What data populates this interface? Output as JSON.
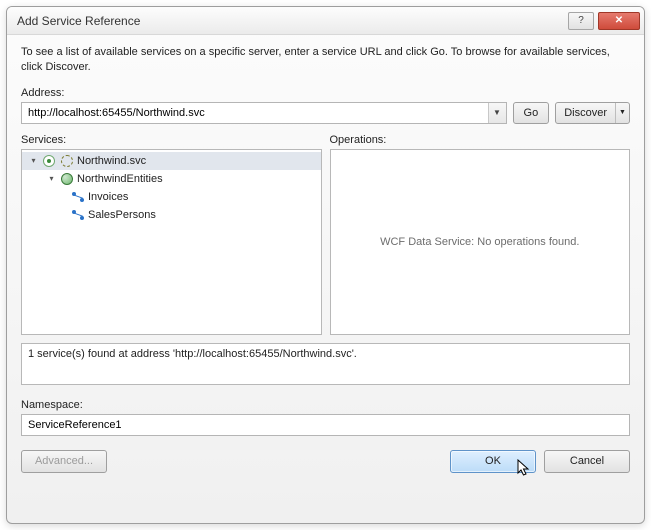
{
  "title": "Add Service Reference",
  "instructions": "To see a list of available services on a specific server, enter a service URL and click Go. To browse for available services, click Discover.",
  "address_label": "Address:",
  "address_value": "http://localhost:65455/Northwind.svc",
  "go_label": "Go",
  "discover_label": "Discover",
  "services_label": "Services:",
  "operations_label": "Operations:",
  "operations_empty": "WCF Data Service: No operations found.",
  "tree": {
    "root": {
      "label": "Northwind.svc",
      "expanded": true,
      "selected": true
    },
    "child": {
      "label": "NorthwindEntities",
      "expanded": true
    },
    "leaves": [
      {
        "label": "Invoices"
      },
      {
        "label": "SalesPersons"
      }
    ]
  },
  "status_text": "1 service(s) found at address 'http://localhost:65455/Northwind.svc'.",
  "namespace_label": "Namespace:",
  "namespace_value": "ServiceReference1",
  "advanced_label": "Advanced...",
  "ok_label": "OK",
  "cancel_label": "Cancel"
}
